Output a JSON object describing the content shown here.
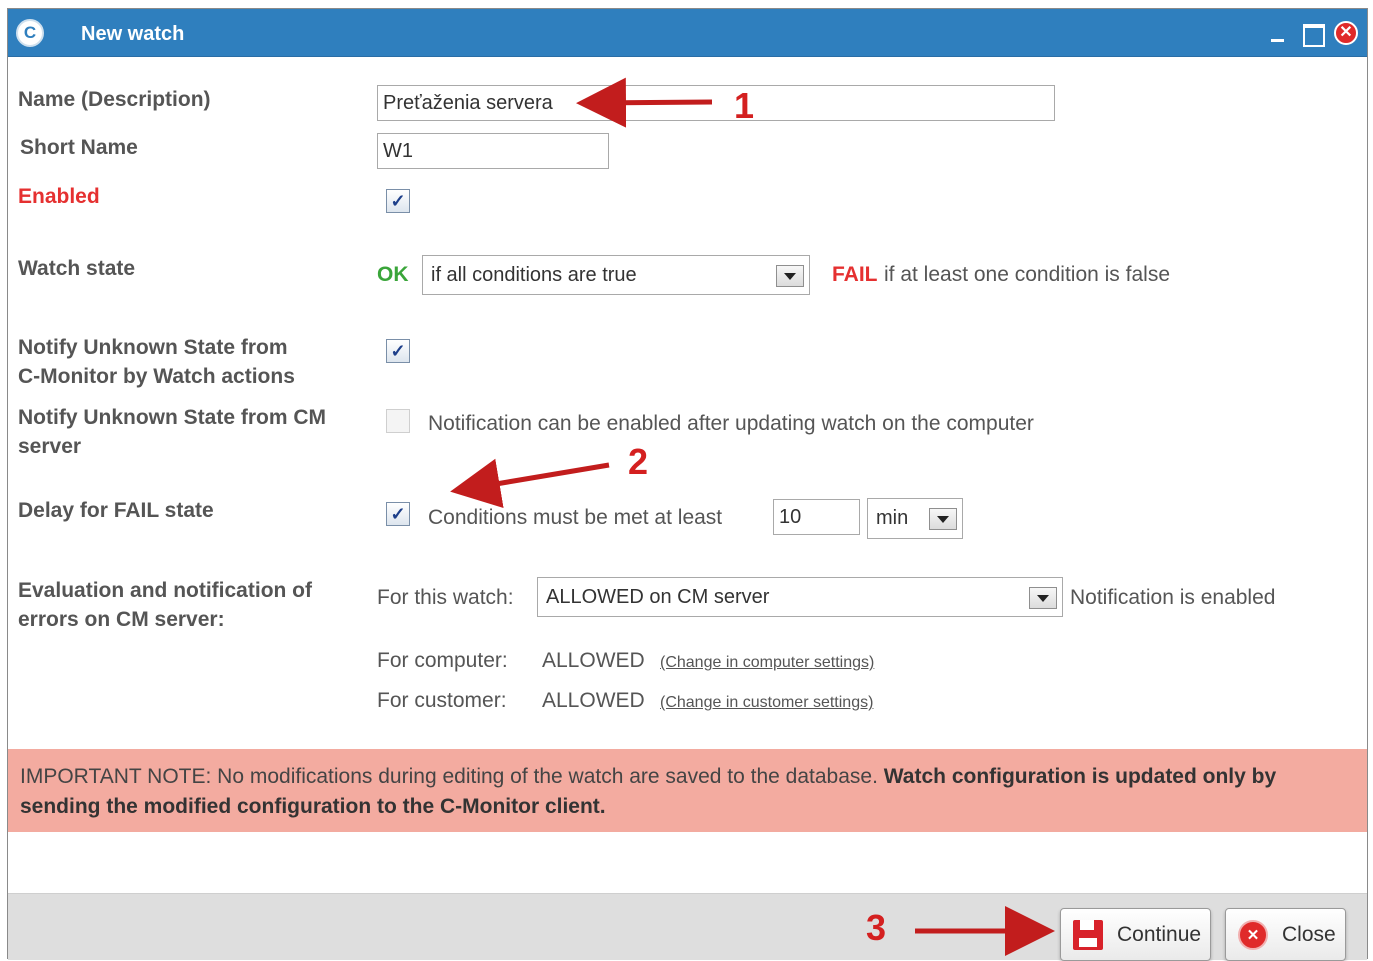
{
  "window": {
    "title": "New watch",
    "app_icon": "C",
    "buttons": {
      "minimize_icon": "minimize-icon",
      "maximize_icon": "maximize-icon",
      "close_icon": "close-icon"
    }
  },
  "form": {
    "name_label": "Name (Description)",
    "name_value": "Preťaženia servera",
    "short_name_label": "Short Name",
    "short_name_value": "W1",
    "enabled_label": "Enabled",
    "enabled_checked": true,
    "watch_state_label": "Watch state",
    "ok_label": "OK",
    "ok_condition_value": "if all conditions are true",
    "fail_label": "FAIL",
    "fail_text": "if at least one condition is false",
    "notify_unknown_cmonitor_label_1": "Notify Unknown State from",
    "notify_unknown_cmonitor_label_2": "C-Monitor by Watch actions",
    "notify_unknown_cmonitor_checked": true,
    "notify_unknown_cm_label_1": "Notify Unknown State from CM",
    "notify_unknown_cm_label_2": "server",
    "notify_unknown_cm_checked": false,
    "notify_unknown_cm_text": "Notification can be enabled after updating watch on the computer",
    "delay_fail_label": "Delay for FAIL state",
    "delay_fail_checked": true,
    "delay_fail_text": "Conditions must be met at least",
    "delay_value": "10",
    "delay_unit": "min",
    "eval_label_1": "Evaluation and notification of",
    "eval_label_2": "errors on CM server:",
    "for_watch_label": "For this watch:",
    "for_watch_value": "ALLOWED on CM server",
    "for_watch_status": "Notification is enabled",
    "for_computer_label": "For computer:",
    "for_computer_value": "ALLOWED",
    "for_computer_link": "(Change in computer settings)",
    "for_customer_label": "For customer:",
    "for_customer_value": "ALLOWED",
    "for_customer_link": "(Change in customer settings)"
  },
  "note": {
    "normal": "IMPORTANT NOTE: No modifications during editing of the watch are saved to the database. ",
    "bold": "Watch configuration is updated only by sending the modified configuration to the C-Monitor client."
  },
  "footer": {
    "continue_label": "Continue",
    "close_label": "Close"
  },
  "annotations": {
    "one": "1",
    "two": "2",
    "three": "3",
    "color": "#d42020"
  }
}
